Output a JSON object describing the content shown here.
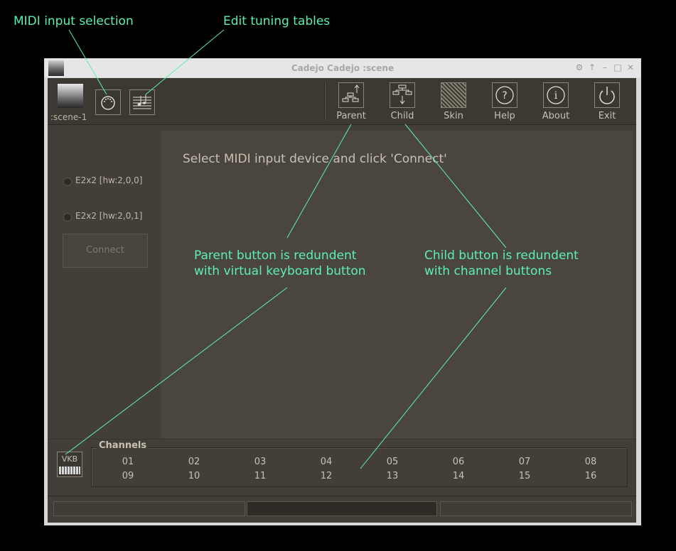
{
  "annotations": {
    "midi_input": "MIDI input selection",
    "edit_tuning": "Edit tuning tables",
    "parent_note": "Parent button is redundent\nwith virtual keyboard button",
    "child_note": "Child button is redundent\nwith channel buttons"
  },
  "window": {
    "title": "Cadejo Cadejo :scene"
  },
  "toolbar": {
    "scene_label": ":scene-1",
    "buttons": [
      {
        "label": "Parent",
        "icon": "parent-tree-icon"
      },
      {
        "label": "Child",
        "icon": "child-tree-icon"
      },
      {
        "label": "Skin",
        "icon": "skin-texture-icon"
      },
      {
        "label": "Help",
        "icon": "help-icon"
      },
      {
        "label": "About",
        "icon": "info-icon"
      },
      {
        "label": "Exit",
        "icon": "power-icon"
      }
    ]
  },
  "midi": {
    "devices": [
      "E2x2  [hw:2,0,0]",
      "E2x2  [hw:2,0,1]"
    ],
    "connect_label": "Connect",
    "prompt": "Select MIDI input device and click 'Connect'"
  },
  "bottom": {
    "vkb_label": "VKB",
    "channels_title": "Channels",
    "channels": [
      "01",
      "02",
      "03",
      "04",
      "05",
      "06",
      "07",
      "08",
      "09",
      "10",
      "11",
      "12",
      "13",
      "14",
      "15",
      "16"
    ]
  },
  "colors": {
    "annotation": "#5cf0b0",
    "panel": "#433f38",
    "text": "#c7c1b2"
  }
}
